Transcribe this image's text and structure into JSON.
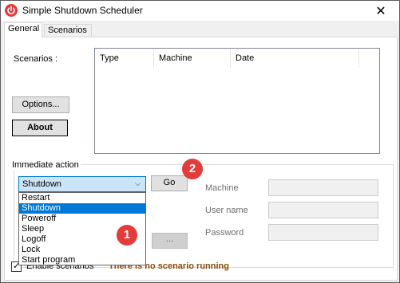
{
  "window": {
    "title": "Simple Shutdown Scheduler",
    "icon": "power-icon",
    "close_glyph": "✕"
  },
  "tabs": [
    {
      "label": "General",
      "active": true
    },
    {
      "label": "Scenarios",
      "active": false
    }
  ],
  "scenarios": {
    "label": "Scenarios :",
    "columns": [
      "Type",
      "Machine",
      "Date"
    ],
    "rows": []
  },
  "buttons": {
    "options": "Options...",
    "about": "About",
    "go": "Go",
    "browse": "..."
  },
  "immediate_action": {
    "title": "Immediate action",
    "selected": "Shutdown",
    "options": [
      "Restart",
      "Shutdown",
      "Poweroff",
      "Sleep",
      "Logoff",
      "Lock",
      "Start program"
    ],
    "selected_index": 1
  },
  "remote": {
    "machine_label": "Machine",
    "username_label": "User name",
    "password_label": "Password",
    "machine_value": "",
    "username_value": "",
    "password_value": ""
  },
  "footer": {
    "enable_label": "Enable scenarios",
    "enable_checked": true,
    "status": "There is no scenario running"
  },
  "annotations": [
    "1",
    "2"
  ],
  "colors": {
    "badge": "#e33a3a",
    "selection": "#0078d7",
    "status": "#8b4a0b"
  }
}
